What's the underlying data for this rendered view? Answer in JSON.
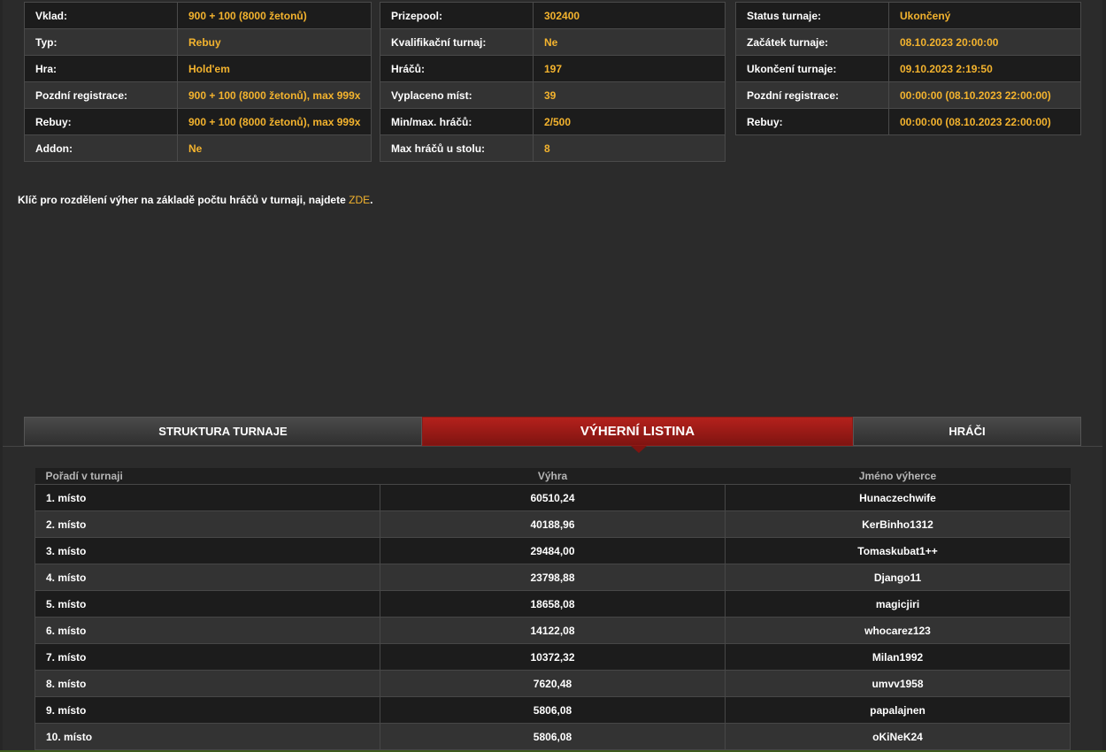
{
  "info_left": [
    {
      "label": "Vklad:",
      "value": "900 + 100 (8000 žetonů)"
    },
    {
      "label": "Typ:",
      "value": "Rebuy"
    },
    {
      "label": "Hra:",
      "value": "Hold'em"
    },
    {
      "label": "Pozdní registrace:",
      "value": "900 + 100 (8000 žetonů), max 999x"
    },
    {
      "label": "Rebuy:",
      "value": "900 + 100 (8000 žetonů), max 999x"
    },
    {
      "label": "Addon:",
      "value": "Ne"
    }
  ],
  "info_mid": [
    {
      "label": "Prizepool:",
      "value": "302400"
    },
    {
      "label": "Kvalifikační turnaj:",
      "value": "Ne"
    },
    {
      "label": "Hráčů:",
      "value": "197"
    },
    {
      "label": "Vyplaceno míst:",
      "value": "39"
    },
    {
      "label": "Min/max. hráčů:",
      "value": "2/500"
    },
    {
      "label": "Max hráčů u stolu:",
      "value": "8"
    }
  ],
  "info_right": [
    {
      "label": "Status turnaje:",
      "value": "Ukončený"
    },
    {
      "label": "Začátek turnaje:",
      "value": "08.10.2023 20:00:00"
    },
    {
      "label": "Ukončení turnaje:",
      "value": "09.10.2023 2:19:50"
    },
    {
      "label": "Pozdní registrace:",
      "value": "00:00:00 (08.10.2023 22:00:00)"
    },
    {
      "label": "Rebuy:",
      "value": "00:00:00 (08.10.2023 22:00:00)"
    }
  ],
  "note": {
    "text": "Klíč pro rozdělení výher na základě počtu hráčů v turnaji, najdete ",
    "link": "ZDE",
    "suffix": "."
  },
  "tabs": {
    "struktura": "STRUKTURA TURNAJE",
    "vyherni": "VÝHERNÍ LISTINA",
    "hraci": "HRÁČI"
  },
  "results": {
    "headers": [
      "Pořadí v turnaji",
      "Výhra",
      "Jméno výherce"
    ],
    "rows": [
      [
        "1. místo",
        "60510,24",
        "Hunaczechwife"
      ],
      [
        "2. místo",
        "40188,96",
        "KerBinho1312"
      ],
      [
        "3. místo",
        "29484,00",
        "Tomaskubat1++"
      ],
      [
        "4. místo",
        "23798,88",
        "Django11"
      ],
      [
        "5. místo",
        "18658,08",
        "magicjiri"
      ],
      [
        "6. místo",
        "14122,08",
        "whocarez123"
      ],
      [
        "7. místo",
        "10372,32",
        "Milan1992"
      ],
      [
        "8. místo",
        "7620,48",
        "umvv1958"
      ],
      [
        "9. místo",
        "5806,08",
        "papalajnen"
      ],
      [
        "10. místo",
        "5806,08",
        "oKiNeK24"
      ]
    ]
  },
  "colors": {
    "accent": "#f3b32e",
    "active_tab": "#b4211c",
    "background": "#2b2b2b"
  }
}
